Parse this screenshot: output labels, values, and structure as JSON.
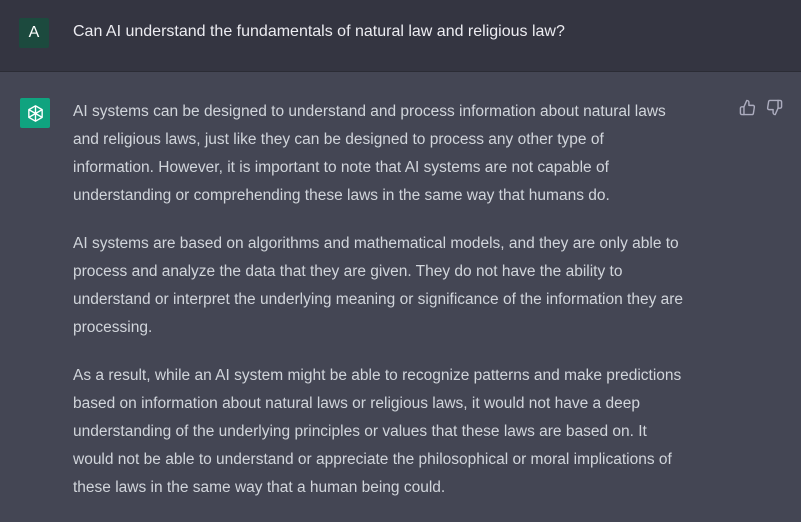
{
  "user": {
    "avatar_letter": "A",
    "question": "Can AI understand the fundamentals of natural law and religious law?"
  },
  "assistant": {
    "paragraphs": [
      [
        "AI systems can be designed to understand and process information about natural laws",
        "and religious laws, just like they can be designed to process any other type of",
        "information. However, it is important to note that AI systems are not capable of",
        "understanding or comprehending these laws in the same way that humans do."
      ],
      [
        "AI systems are based on algorithms and mathematical models, and they are only able to",
        "process and analyze the data that they are given. They do not have the ability to",
        "understand or interpret the underlying meaning or significance of the information they are",
        "processing."
      ],
      [
        "As a result, while an AI system might be able to recognize patterns and make predictions",
        "based on information about natural laws or religious laws, it would not have a deep",
        "understanding of the underlying principles or values that these laws are based on. It",
        "would not be able to understand or appreciate the philosophical or moral implications of",
        "these laws in the same way that a human being could."
      ]
    ]
  },
  "icons": {
    "assistant_avatar": "openai-logo-icon",
    "thumbs_up": "thumbs-up-icon",
    "thumbs_down": "thumbs-down-icon"
  },
  "colors": {
    "user_background": "#343541",
    "assistant_background": "#444654",
    "assistant_avatar": "#10a37f",
    "user_avatar": "#1c4a3e"
  }
}
